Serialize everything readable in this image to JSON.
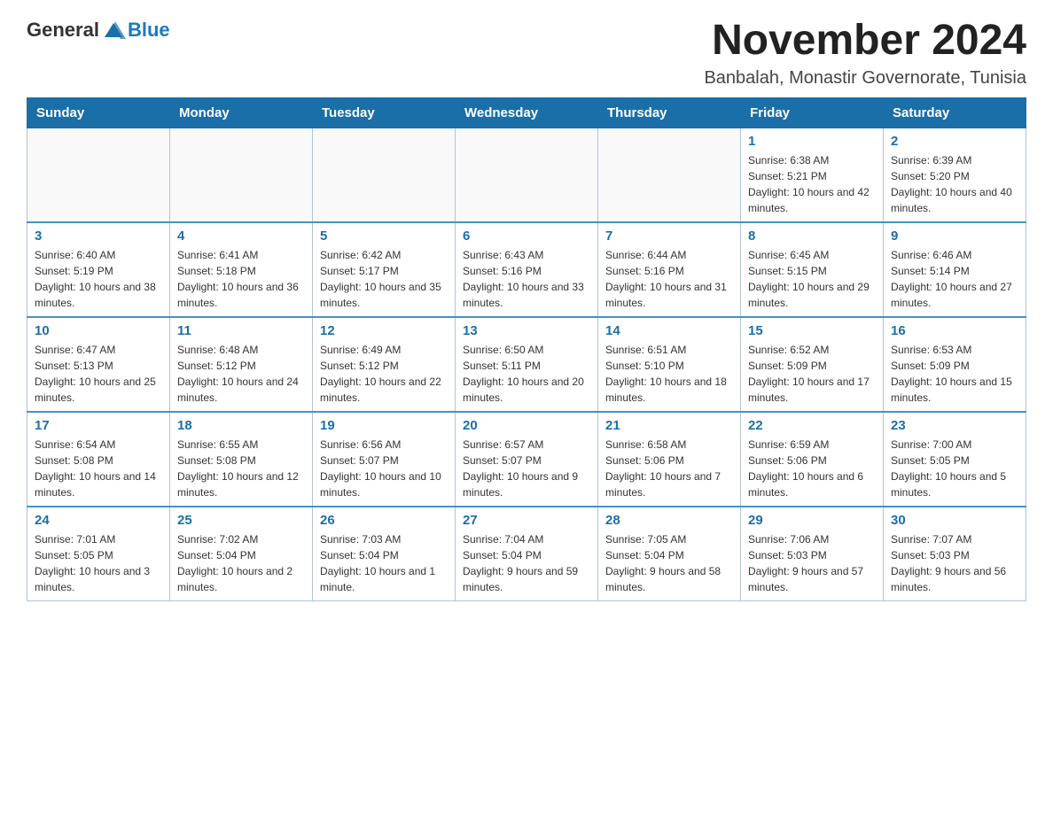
{
  "header": {
    "logo_general": "General",
    "logo_blue": "Blue",
    "month_title": "November 2024",
    "location": "Banbalah, Monastir Governorate, Tunisia"
  },
  "weekdays": [
    "Sunday",
    "Monday",
    "Tuesday",
    "Wednesday",
    "Thursday",
    "Friday",
    "Saturday"
  ],
  "rows": [
    [
      {
        "day": "",
        "info": ""
      },
      {
        "day": "",
        "info": ""
      },
      {
        "day": "",
        "info": ""
      },
      {
        "day": "",
        "info": ""
      },
      {
        "day": "",
        "info": ""
      },
      {
        "day": "1",
        "info": "Sunrise: 6:38 AM\nSunset: 5:21 PM\nDaylight: 10 hours and 42 minutes."
      },
      {
        "day": "2",
        "info": "Sunrise: 6:39 AM\nSunset: 5:20 PM\nDaylight: 10 hours and 40 minutes."
      }
    ],
    [
      {
        "day": "3",
        "info": "Sunrise: 6:40 AM\nSunset: 5:19 PM\nDaylight: 10 hours and 38 minutes."
      },
      {
        "day": "4",
        "info": "Sunrise: 6:41 AM\nSunset: 5:18 PM\nDaylight: 10 hours and 36 minutes."
      },
      {
        "day": "5",
        "info": "Sunrise: 6:42 AM\nSunset: 5:17 PM\nDaylight: 10 hours and 35 minutes."
      },
      {
        "day": "6",
        "info": "Sunrise: 6:43 AM\nSunset: 5:16 PM\nDaylight: 10 hours and 33 minutes."
      },
      {
        "day": "7",
        "info": "Sunrise: 6:44 AM\nSunset: 5:16 PM\nDaylight: 10 hours and 31 minutes."
      },
      {
        "day": "8",
        "info": "Sunrise: 6:45 AM\nSunset: 5:15 PM\nDaylight: 10 hours and 29 minutes."
      },
      {
        "day": "9",
        "info": "Sunrise: 6:46 AM\nSunset: 5:14 PM\nDaylight: 10 hours and 27 minutes."
      }
    ],
    [
      {
        "day": "10",
        "info": "Sunrise: 6:47 AM\nSunset: 5:13 PM\nDaylight: 10 hours and 25 minutes."
      },
      {
        "day": "11",
        "info": "Sunrise: 6:48 AM\nSunset: 5:12 PM\nDaylight: 10 hours and 24 minutes."
      },
      {
        "day": "12",
        "info": "Sunrise: 6:49 AM\nSunset: 5:12 PM\nDaylight: 10 hours and 22 minutes."
      },
      {
        "day": "13",
        "info": "Sunrise: 6:50 AM\nSunset: 5:11 PM\nDaylight: 10 hours and 20 minutes."
      },
      {
        "day": "14",
        "info": "Sunrise: 6:51 AM\nSunset: 5:10 PM\nDaylight: 10 hours and 18 minutes."
      },
      {
        "day": "15",
        "info": "Sunrise: 6:52 AM\nSunset: 5:09 PM\nDaylight: 10 hours and 17 minutes."
      },
      {
        "day": "16",
        "info": "Sunrise: 6:53 AM\nSunset: 5:09 PM\nDaylight: 10 hours and 15 minutes."
      }
    ],
    [
      {
        "day": "17",
        "info": "Sunrise: 6:54 AM\nSunset: 5:08 PM\nDaylight: 10 hours and 14 minutes."
      },
      {
        "day": "18",
        "info": "Sunrise: 6:55 AM\nSunset: 5:08 PM\nDaylight: 10 hours and 12 minutes."
      },
      {
        "day": "19",
        "info": "Sunrise: 6:56 AM\nSunset: 5:07 PM\nDaylight: 10 hours and 10 minutes."
      },
      {
        "day": "20",
        "info": "Sunrise: 6:57 AM\nSunset: 5:07 PM\nDaylight: 10 hours and 9 minutes."
      },
      {
        "day": "21",
        "info": "Sunrise: 6:58 AM\nSunset: 5:06 PM\nDaylight: 10 hours and 7 minutes."
      },
      {
        "day": "22",
        "info": "Sunrise: 6:59 AM\nSunset: 5:06 PM\nDaylight: 10 hours and 6 minutes."
      },
      {
        "day": "23",
        "info": "Sunrise: 7:00 AM\nSunset: 5:05 PM\nDaylight: 10 hours and 5 minutes."
      }
    ],
    [
      {
        "day": "24",
        "info": "Sunrise: 7:01 AM\nSunset: 5:05 PM\nDaylight: 10 hours and 3 minutes."
      },
      {
        "day": "25",
        "info": "Sunrise: 7:02 AM\nSunset: 5:04 PM\nDaylight: 10 hours and 2 minutes."
      },
      {
        "day": "26",
        "info": "Sunrise: 7:03 AM\nSunset: 5:04 PM\nDaylight: 10 hours and 1 minute."
      },
      {
        "day": "27",
        "info": "Sunrise: 7:04 AM\nSunset: 5:04 PM\nDaylight: 9 hours and 59 minutes."
      },
      {
        "day": "28",
        "info": "Sunrise: 7:05 AM\nSunset: 5:04 PM\nDaylight: 9 hours and 58 minutes."
      },
      {
        "day": "29",
        "info": "Sunrise: 7:06 AM\nSunset: 5:03 PM\nDaylight: 9 hours and 57 minutes."
      },
      {
        "day": "30",
        "info": "Sunrise: 7:07 AM\nSunset: 5:03 PM\nDaylight: 9 hours and 56 minutes."
      }
    ]
  ]
}
